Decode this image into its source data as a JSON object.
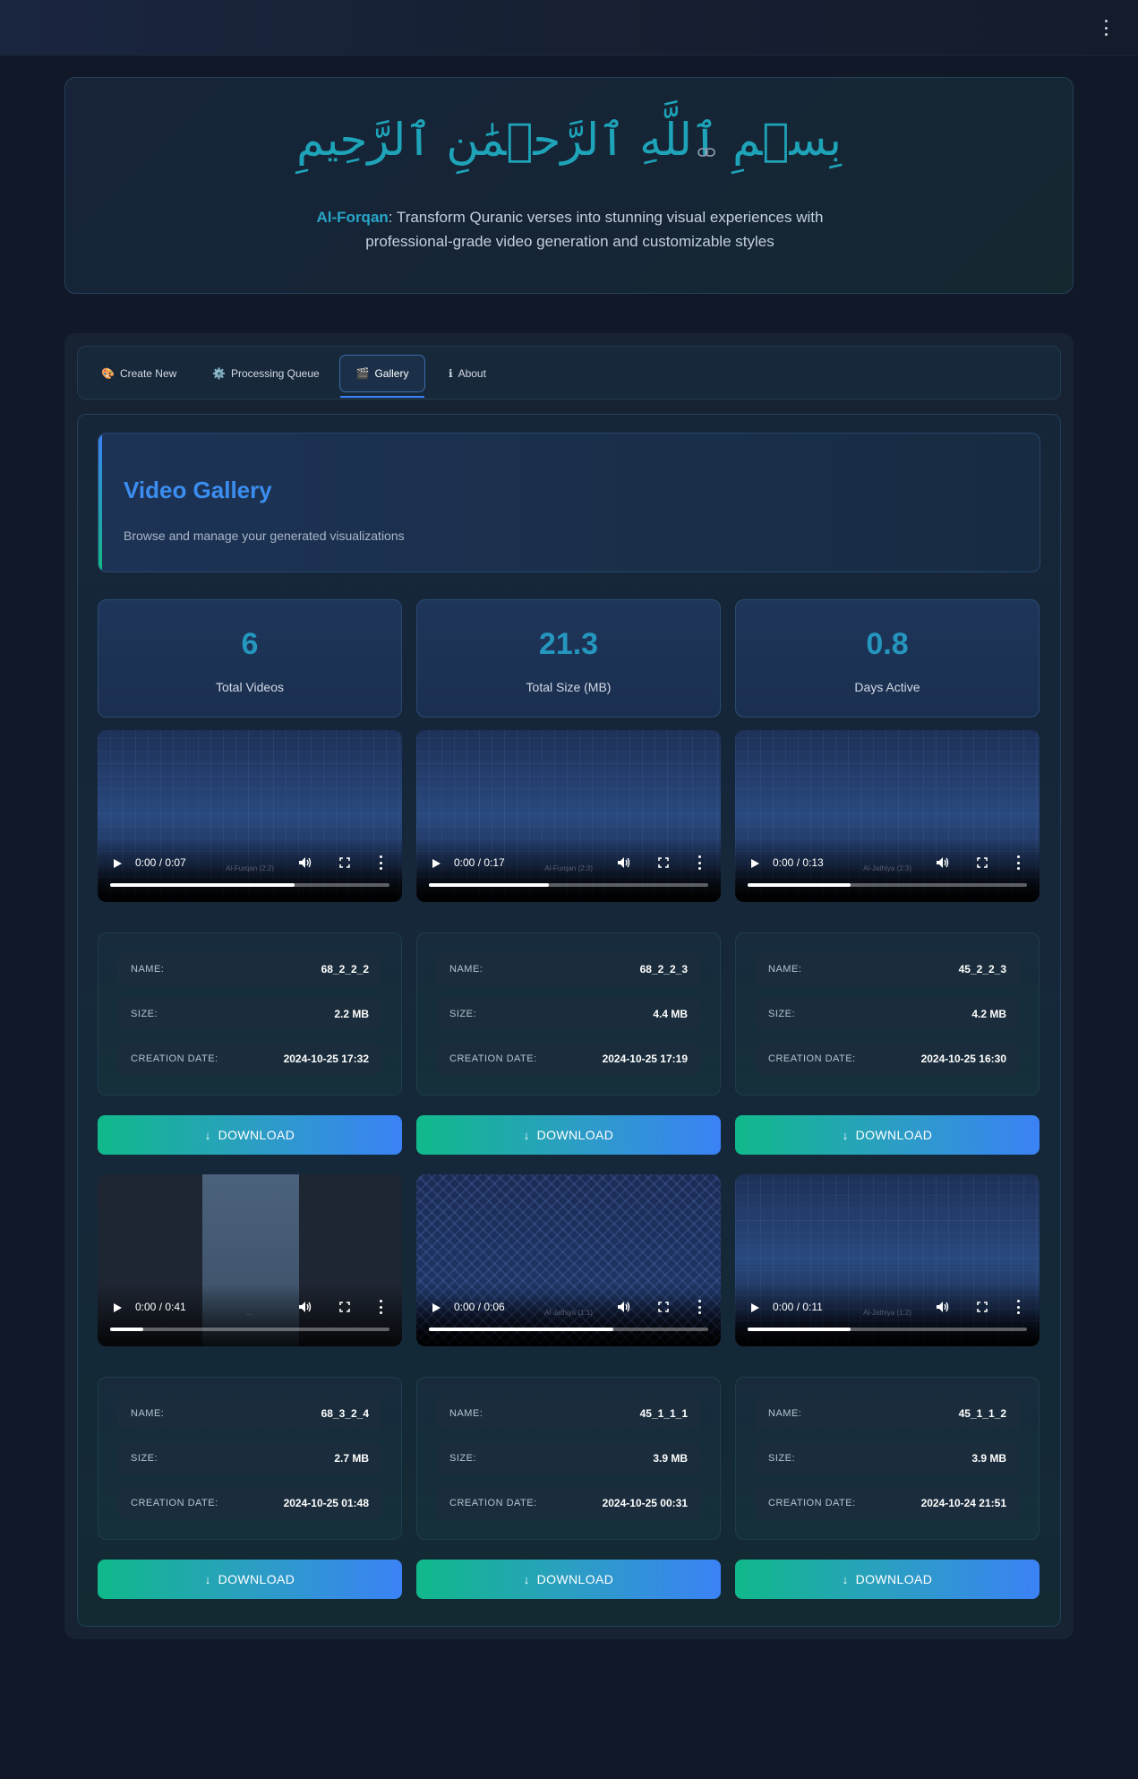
{
  "header": {
    "basmala": "بِسۡمِ ٱللَّهِ ٱلرَّحۡمَٰنِ ٱلرَّحِيمِ",
    "brand": "Al-Forqan",
    "tagline": ": Transform Quranic verses into stunning visual experiences with professional-grade video generation and customizable styles"
  },
  "tabs": [
    {
      "label": "Create New",
      "icon": "🎨"
    },
    {
      "label": "Processing Queue",
      "icon": "⚙️"
    },
    {
      "label": "Gallery",
      "icon": "🎬"
    },
    {
      "label": "About",
      "icon": "ℹ"
    }
  ],
  "active_tab": "Gallery",
  "gallery": {
    "title": "Video Gallery",
    "subtitle": "Browse and manage your generated visualizations"
  },
  "stats": [
    {
      "value": "6",
      "label": "Total Videos"
    },
    {
      "value": "21.3",
      "label": "Total Size (MB)"
    },
    {
      "value": "0.8",
      "label": "Days Active"
    }
  ],
  "labels": {
    "name": "NAME:",
    "size": "SIZE:",
    "date": "CREATION DATE:",
    "download": "DOWNLOAD"
  },
  "videos": [
    {
      "time": "0:00 / 0:07",
      "progress": 0.66,
      "name": "68_2_2_2",
      "size": "2.2 MB",
      "date": "2024-10-25 17:32",
      "caption": "Al-Furqan (2:2)"
    },
    {
      "time": "0:00 / 0:17",
      "progress": 0.43,
      "name": "68_2_2_3",
      "size": "4.4 MB",
      "date": "2024-10-25 17:19",
      "caption": "Al-Furqan (2:3)"
    },
    {
      "time": "0:00 / 0:13",
      "progress": 0.37,
      "name": "45_2_2_3",
      "size": "4.2 MB",
      "date": "2024-10-25 16:30",
      "caption": "Al-Jathiya (2:3)"
    },
    {
      "time": "0:00 / 0:41",
      "progress": 0.12,
      "name": "68_3_2_4",
      "size": "2.7 MB",
      "date": "2024-10-25 01:48",
      "caption": "..."
    },
    {
      "time": "0:00 / 0:06",
      "progress": 0.66,
      "name": "45_1_1_1",
      "size": "3.9 MB",
      "date": "2024-10-25 00:31",
      "caption": "Al-Jathiya (1:1)"
    },
    {
      "time": "0:00 / 0:11",
      "progress": 0.37,
      "name": "45_1_1_2",
      "size": "3.9 MB",
      "date": "2024-10-24 21:51",
      "caption": "Al-Jathiya (1:2)"
    }
  ],
  "colors": {
    "accent": "#3b82f6",
    "teal": "#10b981",
    "stat": "#2596be",
    "background": "#111827"
  }
}
